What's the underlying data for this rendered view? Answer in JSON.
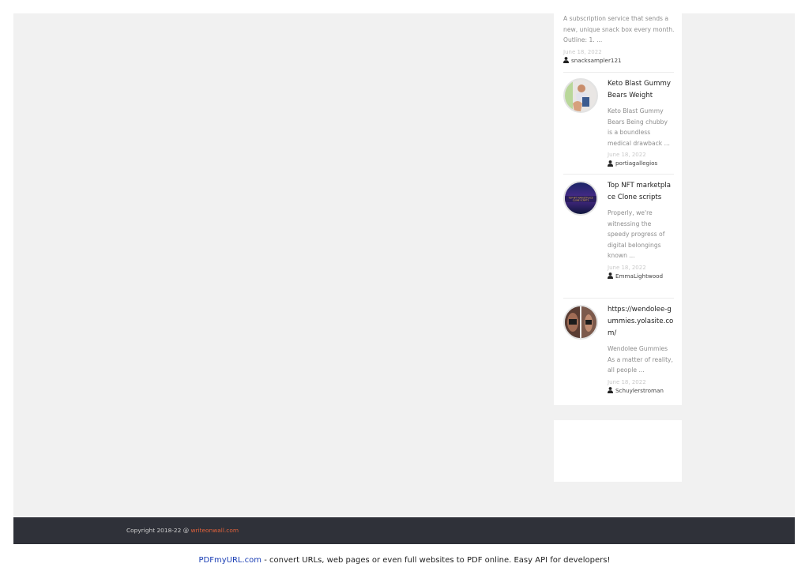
{
  "sidebar": {
    "top_post": {
      "excerpt": "A subscription service that sends a new, unique snack box every month. Outline: 1. ...",
      "date": "June 18, 2022",
      "author": "snacksampler121"
    },
    "posts": [
      {
        "title": "Keto Blast Gummy Bears Weight",
        "excerpt": "Keto Blast Gummy Bears Being chubby is a boundless medical drawback ...",
        "date": "June 18, 2022",
        "author": "portiagallegios",
        "thumb_icon": "woman-fitness-photo"
      },
      {
        "title": "Top NFT marketplace Clone scripts",
        "excerpt": "Properly, we're witnessing the speedy progress of digital belongings known ...",
        "date": "June 18, 2022",
        "author": "EmmaLightwood",
        "thumb_icon": "nft-marketplace-banner",
        "thumb_text": "TOP NFT MARKETPLACE CLONE SCRIPTS"
      },
      {
        "title": "https://wendolee-gummies.yolasite.com/",
        "excerpt": "Wendolee Gummies As a matter of reality, all people ...",
        "date": "June 18, 2022",
        "author": "Schuylerstroman",
        "thumb_icon": "before-after-photo"
      }
    ]
  },
  "footer": {
    "copyright_prefix": "Copyright 2018-22 @ ",
    "site_link": "writeonwall.com"
  },
  "pdf_bar": {
    "link": "PDFmyURL.com",
    "text": " - convert URLs, web pages or even full websites to PDF online. Easy API for developers!"
  },
  "colors": {
    "page_bg": "#f1f1f1",
    "footer_bg": "#2f3139",
    "link_accent": "#e3623b",
    "pdf_link": "#1a3eb4"
  }
}
